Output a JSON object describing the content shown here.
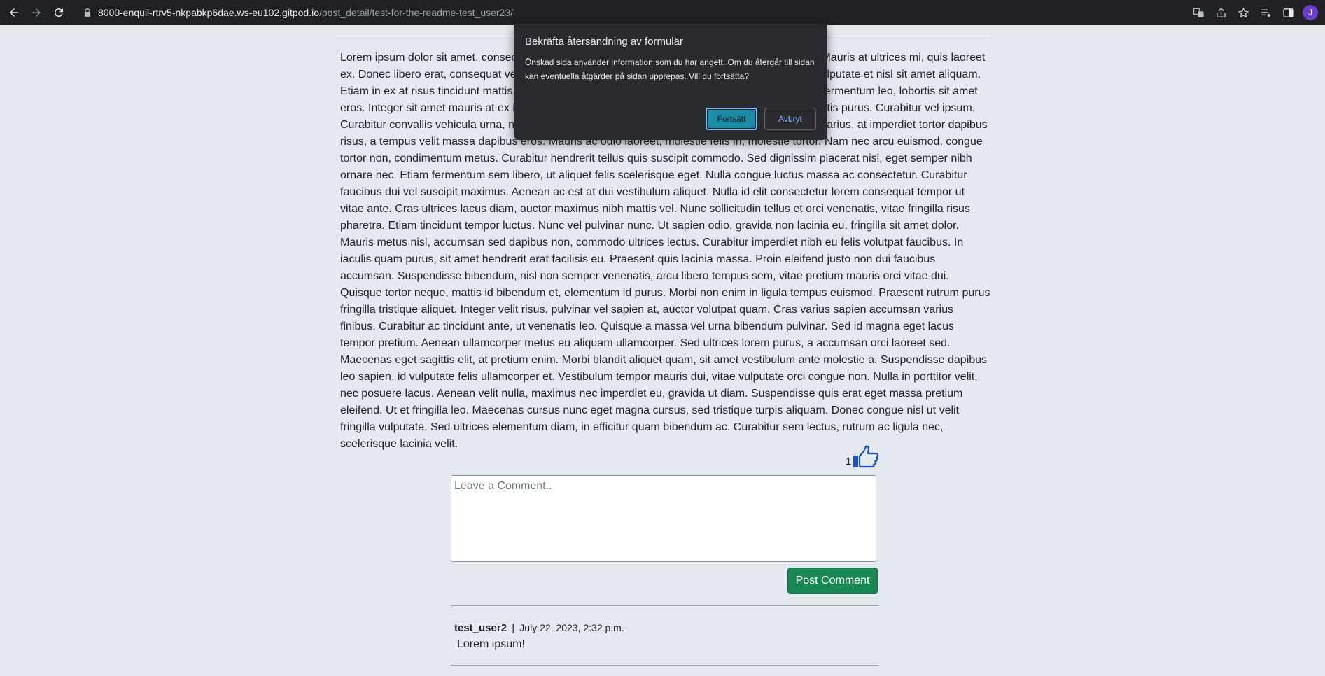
{
  "browser": {
    "url_host": "8000-enquil-rtrv5-nkpabkp6dae.ws-eu102.gitpod.io",
    "url_path": "/post_detail/test-for-the-readme-test_user23/",
    "profile_initial": "J"
  },
  "post": {
    "body": "Lorem ipsum dolor sit amet, consectetur adipiscing elit. Aenean venenatis non diam sed congue. Mauris at ultrices mi, quis laoreet ex. Donec libero erat, consequat vel iaculis at, porta nec mi. Cras a dictum purus. Nam sit amet vulputate et nisl sit amet aliquam. Etiam in ex at risus tincidunt mattis. Aenean ullamcorper, dui id pretium consectetur, tortor augue fermentum leo, lobortis sit amet eros. Integer sit amet mauris at ex iaculis faucibus. Fusce non turpis pulvinar, dapibus nisi at, sagittis purus. Curabitur vel ipsum. Curabitur convallis vehicula urna, nec efficitur nunc facilisis non. Maecenas aliquam eros et nulla varius, at imperdiet tortor dapibus risus, a tempus velit massa dapibus eros. Mauris ac odio laoreet, molestie felis in, molestie tortor. Nam nec arcu euismod, congue tortor non, condimentum metus. Curabitur hendrerit tellus quis suscipit commodo. Sed dignissim placerat nisl, eget semper nibh ornare nec. Etiam fermentum sem libero, ut aliquet felis scelerisque eget. Nulla congue luctus massa ac consectetur. Curabitur faucibus dui vel suscipit maximus. Aenean ac est at dui vestibulum aliquet. Nulla id elit consectetur lorem consequat tempor ut vitae ante. Cras ultrices lacus diam, auctor maximus nibh mattis vel. Nunc sollicitudin tellus et orci venenatis, vitae fringilla risus pharetra. Etiam tincidunt tempor luctus. Nunc vel pulvinar nunc. Ut sapien odio, gravida non lacinia eu, fringilla sit amet dolor. Mauris metus nisl, accumsan sed dapibus non, commodo ultrices lectus. Curabitur imperdiet nibh eu felis volutpat faucibus. In iaculis quam purus, sit amet hendrerit erat facilisis eu. Praesent quis lacinia massa. Proin eleifend justo non dui faucibus accumsan. Suspendisse bibendum, nisl non semper venenatis, arcu libero tempus sem, vitae pretium mauris orci vitae dui. Quisque tortor neque, mattis id bibendum et, elementum id purus. Morbi non enim in ligula tempus euismod. Praesent rutrum purus fringilla tristique aliquet. Integer velit risus, pulvinar vel sapien at, auctor volutpat quam. Cras varius sapien accumsan varius finibus. Curabitur ac tincidunt ante, ut venenatis leo. Quisque a massa vel urna bibendum pulvinar. Sed id magna eget lacus tempor pretium. Aenean ullamcorper metus eu aliquam ullamcorper. Sed ultrices lorem purus, a accumsan orci laoreet sed. Maecenas eget sagittis elit, at pretium enim. Morbi blandit aliquet quam, sit amet vestibulum ante molestie a. Suspendisse dapibus leo sapien, id vulputate felis ullamcorper et. Vestibulum tempor mauris dui, vitae vulputate orci congue non. Nulla in porttitor velit, nec posuere lacus. Aenean velit nulla, maximus nec imperdiet eu, gravida ut diam. Suspendisse quis erat eget massa pretium eleifend. Ut et fringilla leo. Maecenas cursus nunc eget magna cursus, sed tristique turpis aliquam. Donec congue nisl ut velit fringilla vulputate. Sed ultrices elementum diam, in efficitur quam bibendum ac. Curabitur sem lectus, rutrum ac ligula nec, scelerisque lacinia velit.",
    "like_count": "1"
  },
  "comment_form": {
    "placeholder": "Leave a Comment..",
    "submit_label": "Post Comment"
  },
  "comments": [
    {
      "author": "test_user2",
      "separator": "|",
      "date": "July 22, 2023, 2:32 p.m.",
      "text": "Lorem ipsum!"
    }
  ],
  "dialog": {
    "title": "Bekräfta återsändning av formulär",
    "message": "Önskad sida använder information som du har angett. Om du återgår till sidan kan eventuella åtgärder på sidan upprepas. Vill du fortsätta?",
    "confirm_label": "Fortsätt",
    "cancel_label": "Avbryt"
  },
  "colors": {
    "page_bg": "#e4e8ef",
    "accent_green": "#198754",
    "like_blue": "#1f4fb8",
    "dialog_bg": "#292a2d",
    "dialog_confirm": "#1a8ca5"
  }
}
